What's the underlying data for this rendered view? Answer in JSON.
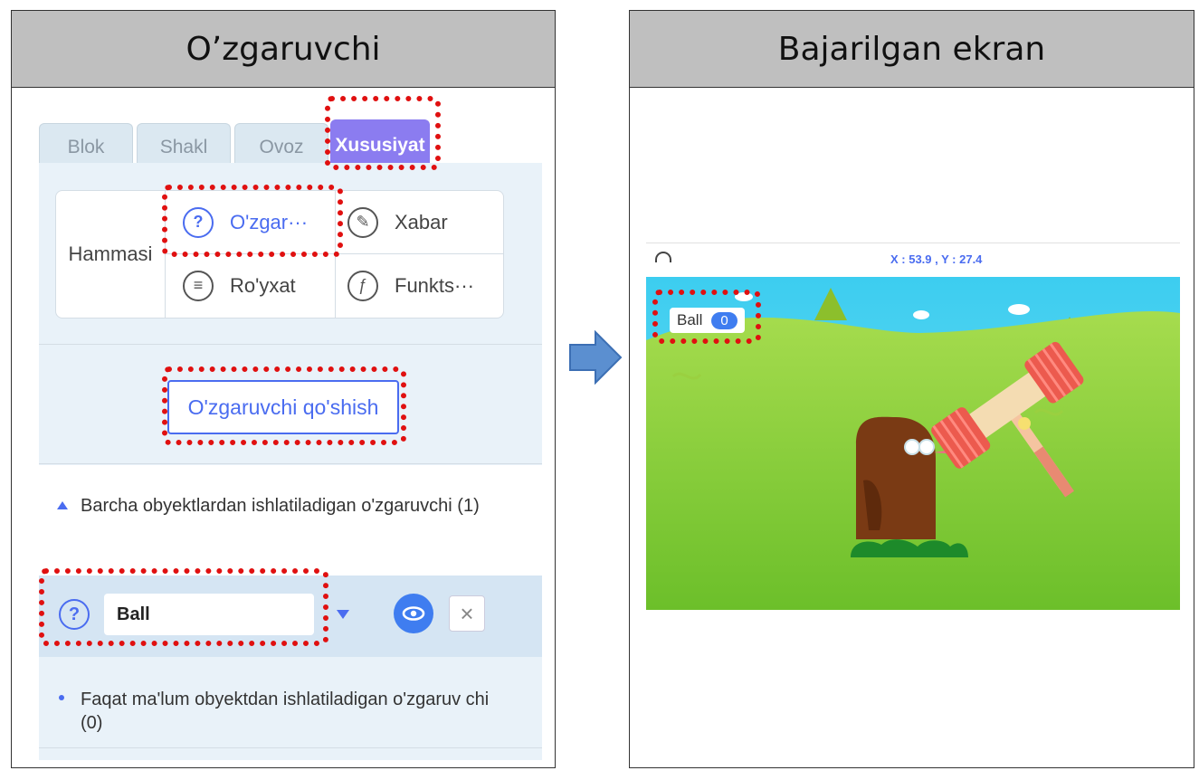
{
  "left_panel": {
    "title": "O’zgaruvchi"
  },
  "right_panel": {
    "title": "Bajarilgan ekran"
  },
  "tabs": [
    {
      "label": "Blok"
    },
    {
      "label": "Shakl"
    },
    {
      "label": "Ovoz"
    },
    {
      "label": "Xususiyat"
    }
  ],
  "categories": {
    "all_label": "Hammasi",
    "items": [
      {
        "label": "O'zgar···",
        "icon": "question-icon"
      },
      {
        "label": "Xabar",
        "icon": "broadcast-icon"
      },
      {
        "label": "Ro'yxat",
        "icon": "list-icon"
      },
      {
        "label": "Funkts···",
        "icon": "function-icon"
      }
    ]
  },
  "add_button": {
    "label": "O'zgaruvchi qo'shish"
  },
  "section_global": {
    "text": "Barcha obyektlardan ishlatiladigan o'zgaruvchi (1)"
  },
  "variable": {
    "name": "Ball"
  },
  "section_local": {
    "text": "Faqat ma'lum obyektdan ishlatiladigan o'zgaruv chi (0)"
  },
  "stage": {
    "coords": "X : 53.9 , Y : 27.4",
    "monitor_label": "Ball",
    "monitor_value": "0"
  },
  "colors": {
    "accent": "#4a6cf0",
    "active_tab": "#8b7cf0",
    "highlight": "#e01010",
    "arrow": "#5b8fd0"
  }
}
